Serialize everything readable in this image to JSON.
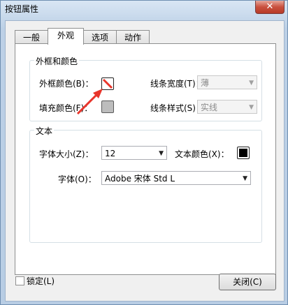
{
  "window": {
    "title": "按钮属性",
    "close_glyph": "✕"
  },
  "tabs": [
    {
      "label": "一般"
    },
    {
      "label": "外观"
    },
    {
      "label": "选项"
    },
    {
      "label": "动作"
    }
  ],
  "border_color_section": {
    "legend": "外框和颜色",
    "border_color_label": "外框颜色(B)：",
    "fill_color_label": "填充颜色(F)：",
    "line_width_label": "线条宽度(T)：",
    "line_width_value": "薄",
    "line_style_label": "线条样式(S)：",
    "line_style_value": "实线",
    "border_color": "#ff0000",
    "fill_color": "#c0c0c0"
  },
  "text_section": {
    "legend": "文本",
    "font_size_label": "字体大小(Z)：",
    "font_size_value": "12",
    "text_color_label": "文本颜色(X)：",
    "text_color": "#000000",
    "font_label": "字体(O)：",
    "font_value": "Adobe 宋体 Std L"
  },
  "footer": {
    "locked_label": "锁定(L)",
    "close_button_label": "关闭(C)"
  },
  "accent_color": "#e8352b"
}
